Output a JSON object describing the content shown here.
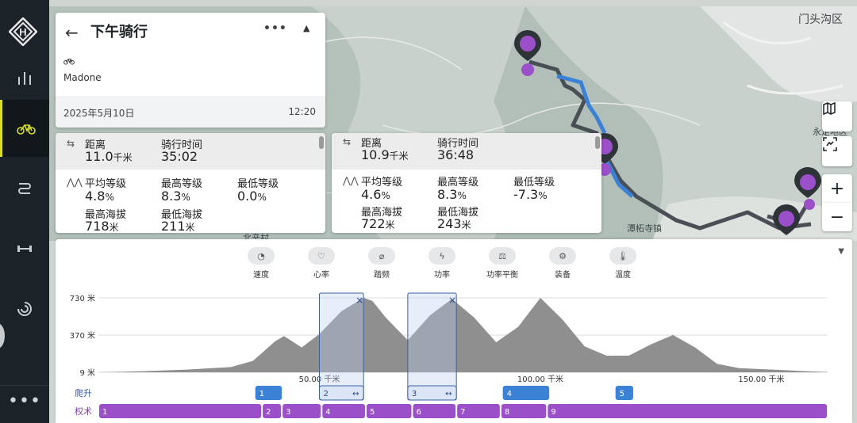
{
  "map": {
    "district_label": "门头沟区",
    "town_label_1": "潭柘寺镇",
    "town_label_2": "北辛村",
    "town_label_3": "永定地区"
  },
  "activity": {
    "title": "下午骑行",
    "bike": "Madone",
    "date": "2025年5月10日",
    "time": "12:20"
  },
  "stats_left": {
    "distance_label": "距离",
    "distance_value": "11.0",
    "distance_unit": "千米",
    "ride_time_label": "骑行时间",
    "ride_time_value": "35:02",
    "avg_grade_label": "平均等级",
    "avg_grade_value": "4.8",
    "pct": "%",
    "max_grade_label": "最高等级",
    "max_grade_value": "8.3",
    "min_grade_label": "最低等级",
    "min_grade_value": "0.0",
    "max_elev_label": "最高海拔",
    "max_elev_value": "718",
    "elev_unit": "米",
    "min_elev_label": "最低海拔",
    "min_elev_value": "211"
  },
  "stats_right": {
    "distance_label": "距离",
    "distance_value": "10.9",
    "distance_unit": "千米",
    "ride_time_label": "骑行时间",
    "ride_time_value": "36:48",
    "avg_grade_label": "平均等级",
    "avg_grade_value": "4.6",
    "pct": "%",
    "max_grade_label": "最高等级",
    "max_grade_value": "8.3",
    "min_grade_label": "最低等级",
    "min_grade_value": "-7.3",
    "max_elev_label": "最高海拔",
    "max_elev_value": "722",
    "elev_unit": "米",
    "min_elev_label": "最低海拔",
    "min_elev_value": "243"
  },
  "metrics": [
    {
      "label": "速度",
      "icon": "speedometer-icon"
    },
    {
      "label": "心率",
      "icon": "heart-icon"
    },
    {
      "label": "踏频",
      "icon": "cadence-icon"
    },
    {
      "label": "功率",
      "icon": "power-icon"
    },
    {
      "label": "功率平衡",
      "icon": "power-balance-icon"
    },
    {
      "label": "装备",
      "icon": "gear-icon"
    },
    {
      "label": "温度",
      "icon": "thermometer-icon"
    }
  ],
  "chart_data": {
    "type": "area",
    "y_ticks": [
      "730 米",
      "370 米",
      "9 米"
    ],
    "x_ticks": [
      "50.00 千米",
      "100.00 千米",
      "150.00 千米"
    ],
    "ylim": [
      9,
      730
    ],
    "xlim": [
      0,
      165
    ],
    "x": [
      0,
      10,
      20,
      30,
      35,
      40,
      42,
      46,
      50,
      55,
      60,
      62,
      65,
      70,
      75,
      80,
      85,
      90,
      95,
      100,
      105,
      110,
      115,
      120,
      125,
      130,
      135,
      140,
      145,
      150,
      155,
      160,
      165
    ],
    "y": [
      9,
      20,
      35,
      60,
      120,
      310,
      360,
      250,
      380,
      600,
      730,
      700,
      540,
      320,
      560,
      720,
      540,
      300,
      450,
      730,
      520,
      260,
      170,
      170,
      280,
      370,
      250,
      90,
      50,
      40,
      30,
      20,
      12
    ],
    "selections": [
      {
        "from_km": 50,
        "to_km": 60
      },
      {
        "from_km": 70,
        "to_km": 81
      }
    ],
    "climb_label": "爬升",
    "climb_segments": [
      {
        "label": "1",
        "from_km": 35.5,
        "to_km": 41.5
      },
      {
        "label": "2",
        "from_km": 50,
        "to_km": 60
      },
      {
        "label": "3",
        "from_km": 70,
        "to_km": 81
      },
      {
        "label": "4",
        "from_km": 91.5,
        "to_km": 102
      },
      {
        "label": "5",
        "from_km": 117,
        "to_km": 121
      }
    ],
    "segment_label": "权术",
    "segments": [
      {
        "label": "1",
        "from_km": 0,
        "to_km": 37
      },
      {
        "label": "2",
        "from_km": 37,
        "to_km": 41.5
      },
      {
        "label": "3",
        "from_km": 41.5,
        "to_km": 50.5
      },
      {
        "label": "4",
        "from_km": 50.5,
        "to_km": 60.5
      },
      {
        "label": "5",
        "from_km": 60.5,
        "to_km": 71
      },
      {
        "label": "6",
        "from_km": 71,
        "to_km": 81
      },
      {
        "label": "7",
        "from_km": 81,
        "to_km": 91
      },
      {
        "label": "8",
        "from_km": 91,
        "to_km": 101.5
      },
      {
        "label": "9",
        "from_km": 101.5,
        "to_km": 165
      }
    ]
  },
  "colors": {
    "purple": "#9b4fc8",
    "blue": "#3b82d6",
    "elevation": "#8f8f8f"
  }
}
